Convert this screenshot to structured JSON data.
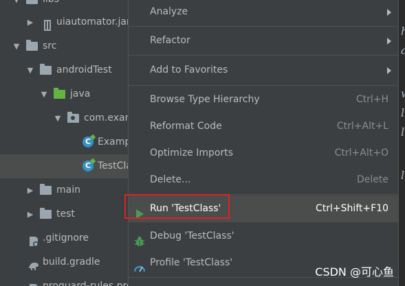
{
  "tree": {
    "items": [
      {
        "label": "libs",
        "icon": "folder-icon"
      },
      {
        "label": "uiautomator.jar",
        "icon": "jar-icon"
      },
      {
        "label": "src",
        "icon": "folder-icon"
      },
      {
        "label": "androidTest",
        "icon": "folder-icon"
      },
      {
        "label": "java",
        "icon": "folder-green-icon"
      },
      {
        "label": "com.exan",
        "icon": "package-icon"
      },
      {
        "label": "Examp",
        "icon": "class-icon"
      },
      {
        "label": "TestCla",
        "icon": "class-icon"
      },
      {
        "label": "main",
        "icon": "folder-icon"
      },
      {
        "label": "test",
        "icon": "folder-icon"
      },
      {
        "label": ".gitignore",
        "icon": "gitignore-icon"
      },
      {
        "label": "build.gradle",
        "icon": "gradle-icon"
      },
      {
        "label": "proguard-rules.pro",
        "icon": "file-icon"
      }
    ]
  },
  "editor": {
    "fragments": [
      "h",
      "a",
      "w",
      "l",
      "l",
      "l"
    ]
  },
  "menu": {
    "items": [
      {
        "label": "Analyze",
        "shortcut": "",
        "submenu": true
      },
      {
        "label": "Refactor",
        "shortcut": "",
        "submenu": true
      },
      {
        "label": "Add to Favorites",
        "shortcut": "",
        "submenu": true
      },
      {
        "label": "Browse Type Hierarchy",
        "shortcut": "Ctrl+H",
        "submenu": false
      },
      {
        "label": "Reformat Code",
        "shortcut": "Ctrl+Alt+L",
        "submenu": false
      },
      {
        "label": "Optimize Imports",
        "shortcut": "Ctrl+Alt+O",
        "submenu": false
      },
      {
        "label": "Delete...",
        "shortcut": "Delete",
        "submenu": false
      },
      {
        "label": "Run 'TestClass'",
        "shortcut": "Ctrl+Shift+F10",
        "submenu": false,
        "icon": "run-icon"
      },
      {
        "label": "Debug 'TestClass'",
        "shortcut": "",
        "submenu": false,
        "icon": "debug-icon"
      },
      {
        "label": "Profile 'TestClass'",
        "shortcut": "",
        "submenu": false,
        "icon": "profile-icon"
      }
    ]
  },
  "colors": {
    "run_icon": "#499c54",
    "debug_icon": "#3592c4",
    "highlight_box": "#e0211f"
  },
  "watermark": "CSDN @可心鱼"
}
